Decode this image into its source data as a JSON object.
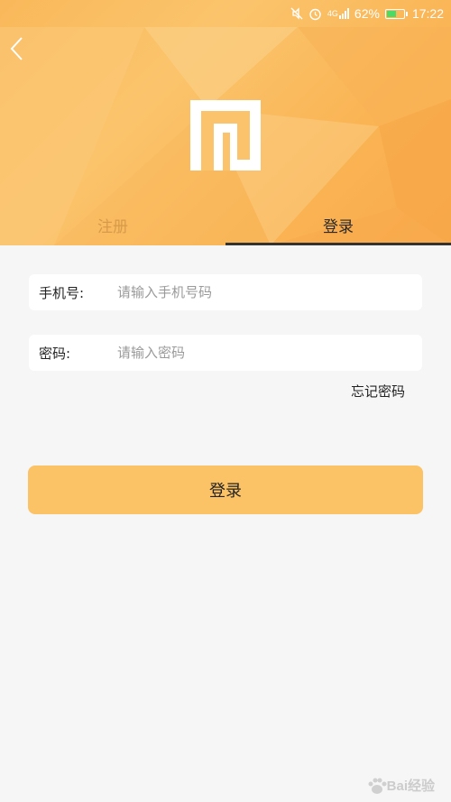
{
  "status_bar": {
    "network": "4G",
    "battery": "62%",
    "battery_level": 0.62,
    "time": "17:22"
  },
  "header": {
    "back_icon": "chevron-left-icon",
    "logo": "app-logo"
  },
  "tabs": [
    {
      "label": "注册",
      "active": false
    },
    {
      "label": "登录",
      "active": true
    }
  ],
  "form": {
    "phone": {
      "label": "手机号:",
      "placeholder": "请输入手机号码",
      "value": ""
    },
    "password": {
      "label": "密码:",
      "placeholder": "请输入密码",
      "value": ""
    },
    "forgot_label": "忘记密码",
    "submit_label": "登录"
  },
  "watermark": {
    "text": "Bai经验"
  },
  "colors": {
    "header_orange": "#fbc46c",
    "button": "#fbc266",
    "page_bg": "#f6f6f6"
  }
}
